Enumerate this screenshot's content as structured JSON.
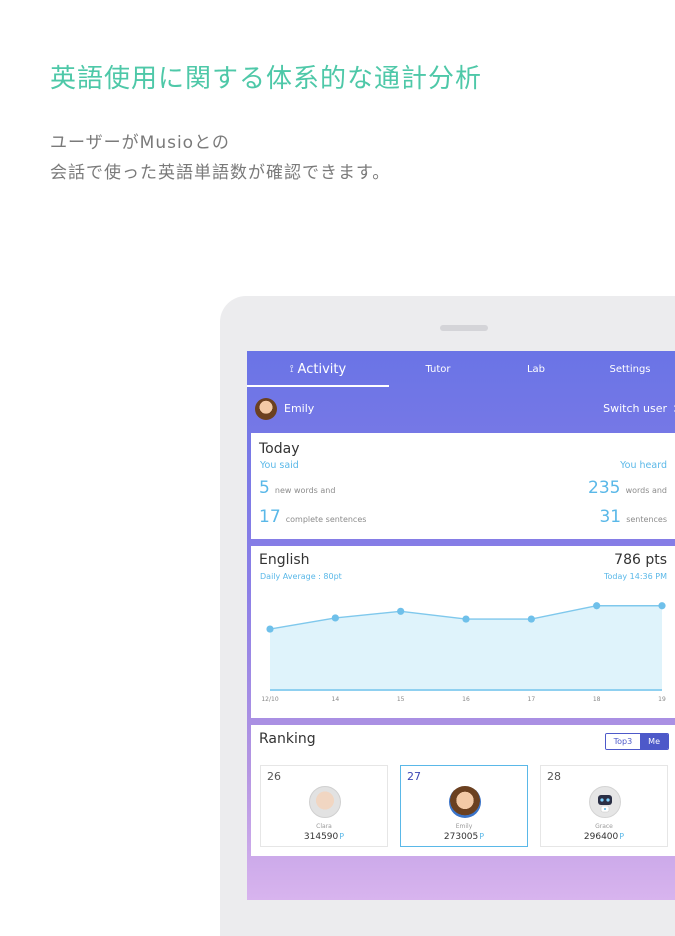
{
  "promo": {
    "headline": "英語使用に関する体系的な通計分析",
    "subline1": "ユーザーがMusioとの",
    "subline2": "会話で使った英語単語数が確認できます。"
  },
  "tabs": [
    {
      "label": "Activity",
      "icon": "activity-icon",
      "active": true
    },
    {
      "label": "Tutor",
      "active": false
    },
    {
      "label": "Lab",
      "active": false
    },
    {
      "label": "Settings",
      "active": false
    }
  ],
  "user": {
    "name": "Emily",
    "switch_label": "Switch user"
  },
  "today": {
    "title": "Today",
    "you_said": "You said",
    "you_heard": "You heard",
    "said_words": "5",
    "said_words_label": "new words and",
    "said_sentences": "17",
    "said_sentences_label": "complete sentences",
    "heard_words": "235",
    "heard_words_label": "words and",
    "heard_sentences": "31",
    "heard_sentences_label": "sentences"
  },
  "english": {
    "title": "English",
    "points": "786 pts",
    "daily_average": "Daily Average : 80pt",
    "timestamp": "Today 14:36 PM"
  },
  "chart_data": {
    "type": "area",
    "categories": [
      "12/10",
      "14",
      "15",
      "16",
      "17",
      "18",
      "19"
    ],
    "values": [
      540,
      640,
      700,
      630,
      630,
      750,
      750
    ],
    "ylim": [
      0,
      1000
    ],
    "grid": false,
    "colors": {
      "line": "#7fc8ec",
      "fill": "#dff3fb",
      "point": "#6fc0ea",
      "baseline": "#8fd0f0"
    }
  },
  "ranking": {
    "title": "Ranking",
    "toggle_off": "Top3",
    "toggle_on": "Me",
    "entries": [
      {
        "rank": "26",
        "name": "Clara",
        "points": "314590",
        "unit": "P"
      },
      {
        "rank": "27",
        "name": "Emily",
        "points": "273005",
        "unit": "P"
      },
      {
        "rank": "28",
        "name": "Grace",
        "points": "296400",
        "unit": "P"
      }
    ]
  },
  "colors": {
    "accent_green": "#4ec8a8",
    "header_blue": "#6a74e6",
    "data_blue": "#5ab8e8",
    "toggle_blue": "#4d59c9"
  }
}
